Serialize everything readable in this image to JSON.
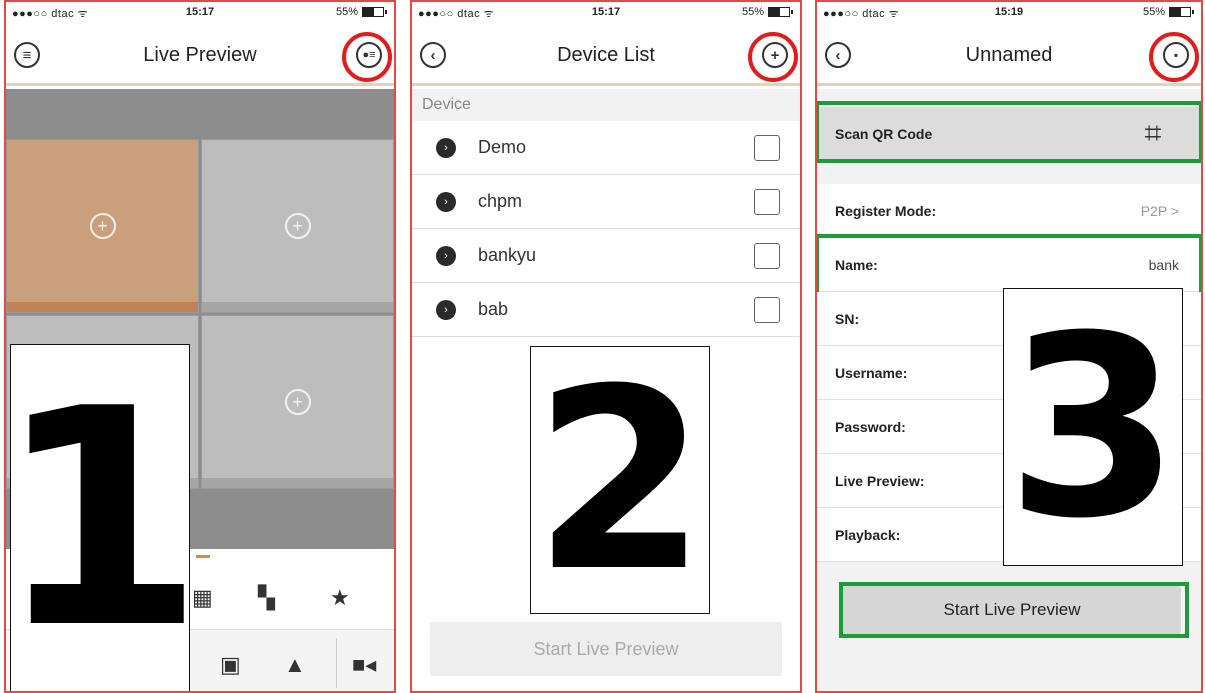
{
  "panels": {
    "live_preview": {
      "status": {
        "carrier": "●●●○○ dtac ᯤ",
        "time": "15:17",
        "battery": "55%"
      },
      "title": "Live Preview",
      "menu_icon": "hamburger-icon",
      "device_icon": "device-list-icon",
      "tile_icon": "add-channel-icon",
      "toolbar_icons": [
        "grid-layout-icon",
        "schedule-icon",
        "favorite-star-icon"
      ],
      "bottom_icons": [
        "snapshot-icon",
        "playback-icon",
        "ptz-icon",
        "screen-icon",
        "alarm-icon",
        "record-icon"
      ],
      "step_number": "1"
    },
    "device_list": {
      "status": {
        "carrier": "●●●○○ dtac ᯤ",
        "time": "15:17",
        "battery": "55%"
      },
      "title": "Device List",
      "section_header": "Device",
      "devices": [
        {
          "name": "Demo"
        },
        {
          "name": "chpm"
        },
        {
          "name": "bankyu"
        },
        {
          "name": "bab"
        }
      ],
      "start_button": "Start Live Preview",
      "step_number": "2"
    },
    "unnamed": {
      "status": {
        "carrier": "●●●○○ dtac ᯤ",
        "time": "15:19",
        "battery": "55%"
      },
      "title": "Unnamed",
      "scan_qr": "Scan QR Code",
      "register_mode": {
        "label": "Register Mode:",
        "value": "P2P >"
      },
      "name": {
        "label": "Name:",
        "value": "bank"
      },
      "sn": {
        "label": "SN:"
      },
      "username": {
        "label": "Username:"
      },
      "password": {
        "label": "Password:"
      },
      "live_preview": {
        "label": "Live Preview:"
      },
      "playback": {
        "label": "Playback:"
      },
      "start_button": "Start Live Preview",
      "step_number": "3"
    }
  },
  "colors": {
    "panel_border": "#e24a4a",
    "highlight_red": "#e41b1b",
    "highlight_green": "#1e9b3a",
    "selected_tile": "#caa07c",
    "accent_orange": "#e08a2c"
  }
}
